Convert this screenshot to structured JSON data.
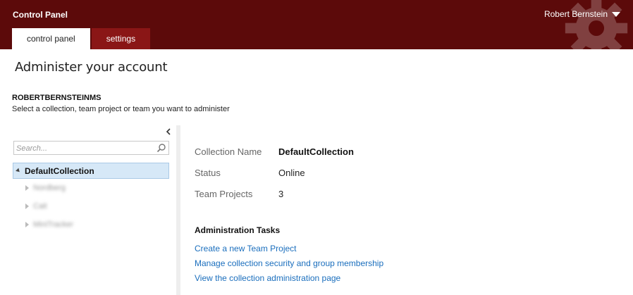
{
  "header": {
    "app_title": "Control Panel",
    "user_name": "Robert Bernstein",
    "background_color": "#5c0a0a",
    "tabs": [
      {
        "label": "control panel",
        "active": true
      },
      {
        "label": "settings",
        "active": false
      }
    ]
  },
  "page": {
    "title": "Administer your account",
    "account_name": "ROBERTBERNSTEINMS",
    "description": "Select a collection, team project or team you want to administer"
  },
  "sidebar": {
    "search_placeholder": "Search...",
    "collapse_icon": "chevron-left-icon",
    "tree_root": "DefaultCollection",
    "tree_children": [
      "Nordberg",
      "Cait",
      "MiniTracker"
    ]
  },
  "details": {
    "rows": [
      {
        "label": "Collection Name",
        "value": "DefaultCollection"
      },
      {
        "label": "Status",
        "value": "Online"
      },
      {
        "label": "Team Projects",
        "value": "3"
      }
    ]
  },
  "tasks": {
    "heading": "Administration Tasks",
    "links": [
      "Create a new Team Project",
      "Manage collection security and group membership",
      "View the collection administration page"
    ],
    "link_color": "#1a6ebd"
  }
}
